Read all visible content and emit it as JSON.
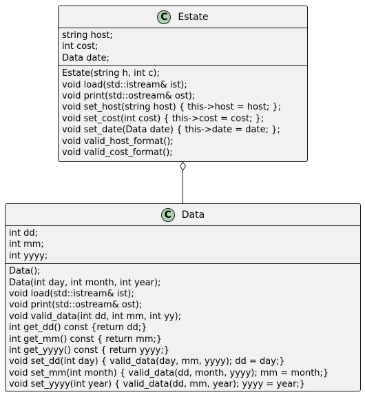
{
  "estate": {
    "stereotype": "C",
    "name": "Estate",
    "fields": [
      "string host;",
      "int cost;",
      "Data date;"
    ],
    "methods": [
      "Estate(string h, int c);",
      "void load(std::istream& ist);",
      "void print(std::ostream& ost);",
      "void set_host(string host) { this->host = host; };",
      "void set_cost(int cost) { this->cost = cost; };",
      "void set_date(Data date) { this->date = date; };",
      "void valid_host_format();",
      "void valid_cost_format();"
    ]
  },
  "data": {
    "stereotype": "C",
    "name": "Data",
    "fields": [
      "int dd;",
      "int mm;",
      "int yyyy;"
    ],
    "methods": [
      "Data();",
      "Data(int day, int month, int year);",
      "void load(std::istream& ist);",
      "void print(std::ostream& ost);",
      "void valid_data(int dd, int mm, int yy);",
      "int get_dd() const {return dd;}",
      "int get_mm() const { return mm;}",
      "int get_yyyy() const { return yyyy;}",
      "void set_dd(int day) { valid_data(day, mm, yyyy); dd = day;}",
      "void set_mm(int month) { valid_data(dd, month, yyyy); mm = month;}",
      "void set_yyyy(int year) { valid_data(dd, mm, year); yyyy = year;}"
    ]
  },
  "relation": {
    "type": "aggregation",
    "from": "Estate",
    "to": "Data"
  }
}
